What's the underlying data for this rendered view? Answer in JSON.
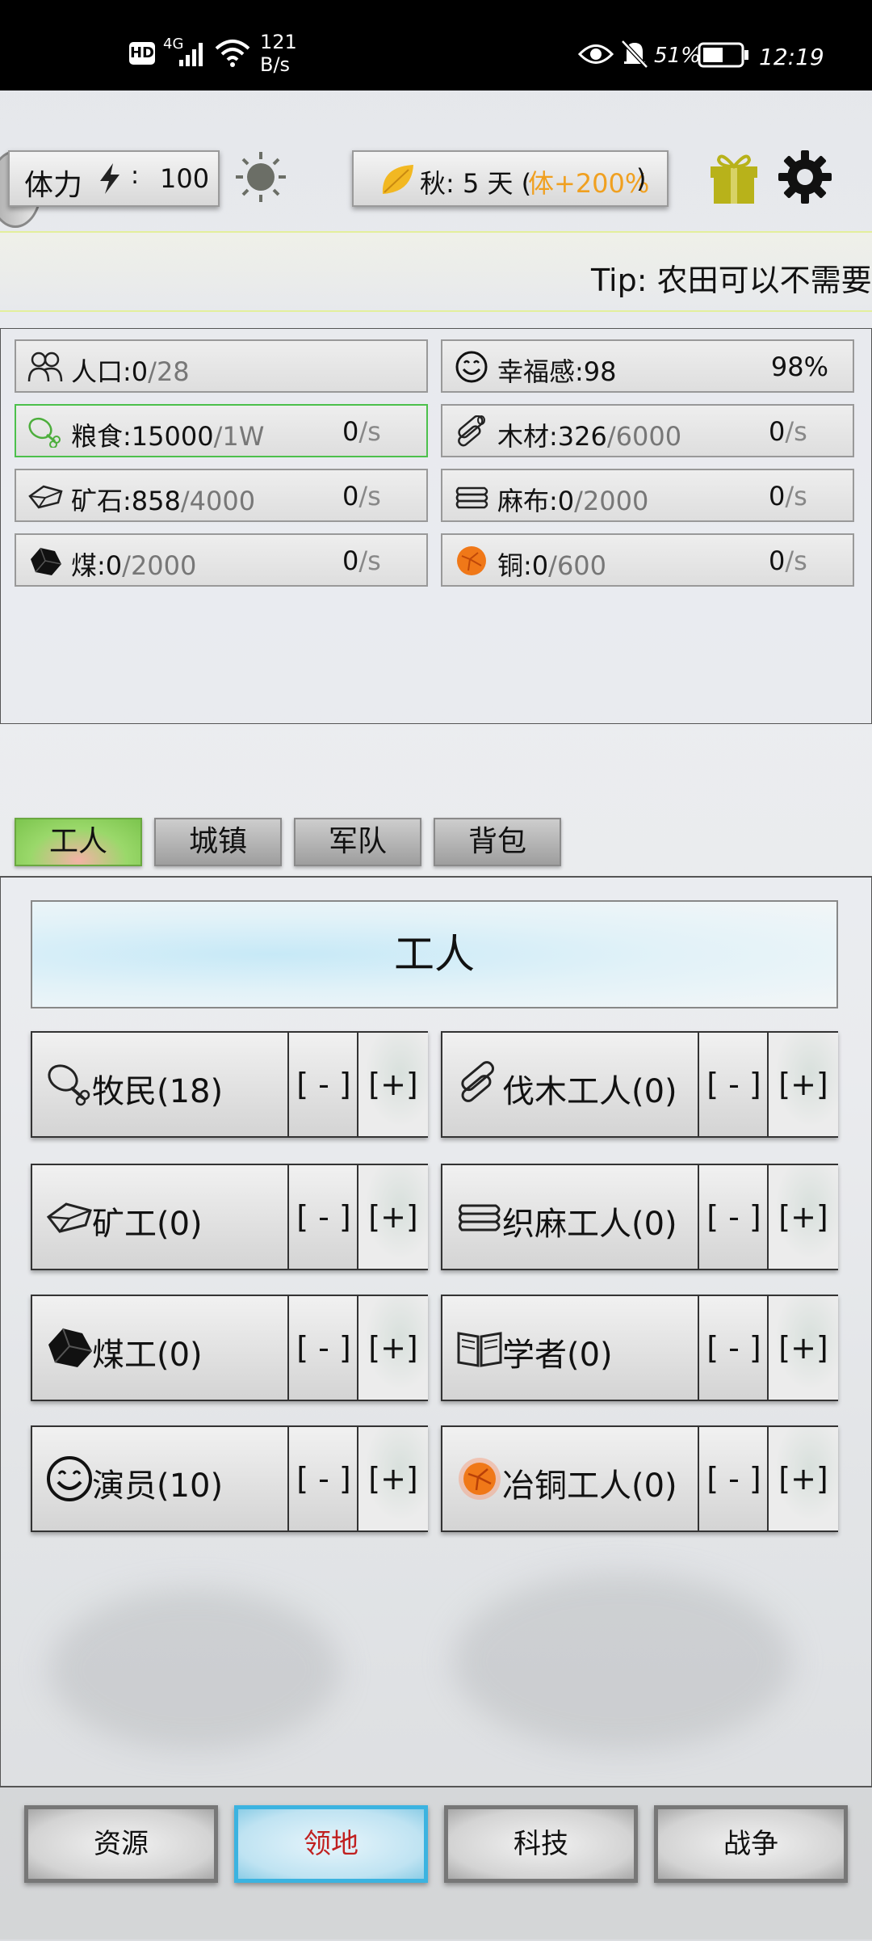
{
  "status_bar": {
    "hd": "HD",
    "network": "4G",
    "speed_value": "121",
    "speed_unit": "B/s",
    "battery": "51%",
    "time": "12:19"
  },
  "top_bar": {
    "stamina_label": "体力",
    "stamina_sep": ":",
    "stamina_value": "100",
    "season_text": "秋: 5 天 (",
    "season_bonus": "体+200%",
    "season_close": ")"
  },
  "tip": {
    "text": "Tip:  农田可以不需要"
  },
  "resources": [
    {
      "icon": "people-icon",
      "name": "人口:",
      "value": "0",
      "max": "/28",
      "rate": "",
      "unit": ""
    },
    {
      "icon": "smile-icon",
      "name": "幸福感:",
      "value": "98",
      "max": "",
      "rate": "",
      "unit": "",
      "percent": "98%"
    },
    {
      "icon": "meat-icon",
      "name": "粮食:",
      "value": "15000",
      "max": "/1W",
      "rate": "0",
      "unit": "/s"
    },
    {
      "icon": "wood-icon",
      "name": "木材:",
      "value": "326",
      "max": "/6000",
      "rate": "0",
      "unit": "/s"
    },
    {
      "icon": "ore-icon",
      "name": "矿石:",
      "value": "858",
      "max": "/4000",
      "rate": "0",
      "unit": "/s"
    },
    {
      "icon": "linen-icon",
      "name": "麻布:",
      "value": "0",
      "max": "/2000",
      "rate": "0",
      "unit": "/s"
    },
    {
      "icon": "coal-icon",
      "name": "煤:",
      "value": "0",
      "max": "/2000",
      "rate": "0",
      "unit": "/s"
    },
    {
      "icon": "copper-icon",
      "name": "铜:",
      "value": "0",
      "max": "/600",
      "rate": "0",
      "unit": "/s"
    }
  ],
  "tabs": [
    "工人",
    "城镇",
    "军队",
    "背包"
  ],
  "worker_header": "工人",
  "workers": [
    {
      "icon": "meat-icon",
      "label": "牧民(18)",
      "minus": "[ - ]",
      "plus": "[+]"
    },
    {
      "icon": "wood-icon",
      "label": "伐木工人(0)",
      "minus": "[ - ]",
      "plus": "[+]"
    },
    {
      "icon": "ore-icon",
      "label": "矿工(0)",
      "minus": "[ - ]",
      "plus": "[+]"
    },
    {
      "icon": "linen-icon",
      "label": "织麻工人(0)",
      "minus": "[ - ]",
      "plus": "[+]"
    },
    {
      "icon": "coal-icon",
      "label": "煤工(0)",
      "minus": "[ - ]",
      "plus": "[+]"
    },
    {
      "icon": "book-icon",
      "label": "学者(0)",
      "minus": "[ - ]",
      "plus": "[+]"
    },
    {
      "icon": "smile-icon",
      "label": "演员(10)",
      "minus": "[ - ]",
      "plus": "[+]"
    },
    {
      "icon": "copper-icon",
      "label": "冶铜工人(0)",
      "minus": "[ - ]",
      "plus": "[+]"
    }
  ],
  "bottom_nav": [
    "资源",
    "领地",
    "科技",
    "战争"
  ],
  "colors": {
    "season_bonus": "#f0a020",
    "active_nav_text": "#c02020",
    "active_tab": "#8ccf5e"
  }
}
